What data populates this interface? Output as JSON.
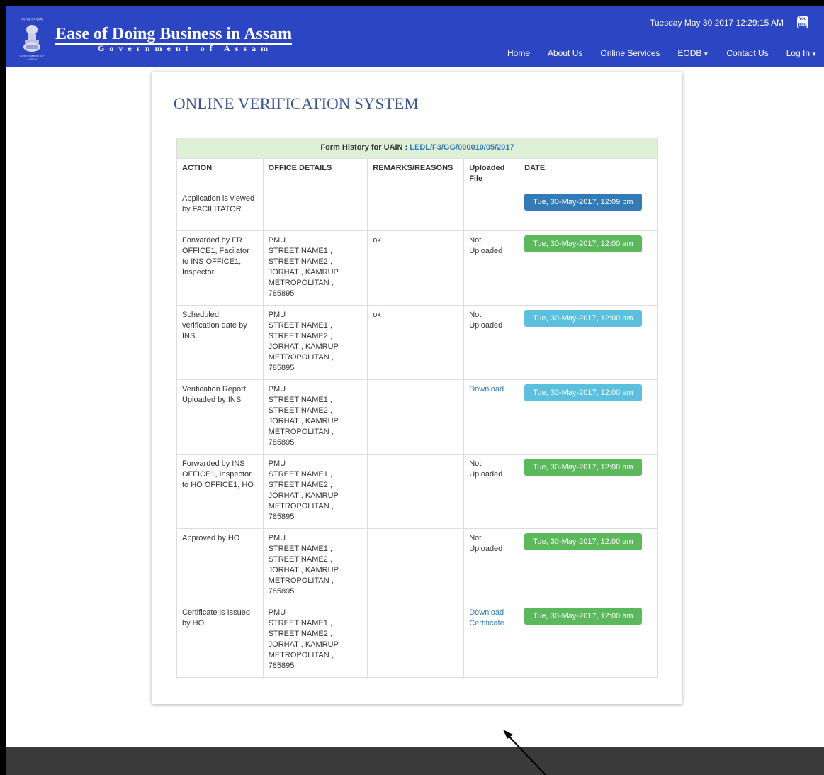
{
  "header": {
    "emblem_top_text": "অসম চৰকাৰ",
    "emblem_bottom_text": "GOVERNMENT OF ASSAM",
    "title": "Ease of Doing Business in Assam",
    "subtitle": "Government of Assam",
    "datetime": "Tuesday May 30 2017 12:29:15 AM",
    "youtube_top": "You",
    "youtube_bottom": "Tube",
    "nav": [
      {
        "label": "Home"
      },
      {
        "label": "About Us"
      },
      {
        "label": "Online Services"
      },
      {
        "label": "EODB",
        "dropdown": true
      },
      {
        "label": "Contact Us"
      },
      {
        "label": "Log In",
        "dropdown": true
      }
    ]
  },
  "main": {
    "page_title": "ONLINE VERIFICATION SYSTEM",
    "caption_prefix": "Form History for UAIN : ",
    "uain": "LEDL/F3/GG/000010/05/2017",
    "columns": [
      "ACTION",
      "OFFICE DETAILS",
      "REMARKS/REASONS",
      "Uploaded File",
      "DATE"
    ],
    "rows": [
      {
        "action": "Application is viewed by FACILITATOR",
        "office": "",
        "remarks": "",
        "file": "",
        "file_is_link": false,
        "date": "Tue, 30-May-2017, 12:09 pm",
        "date_style": "primary"
      },
      {
        "action": "Forwarded by FR OFFICE1, Facilator to INS OFFICE1, Inspector",
        "office": "PMU\nSTREET NAME1 ,\nSTREET NAME2 ,\nJORHAT , KAMRUP\nMETROPOLITAN ,\n785895",
        "remarks": "ok",
        "file": "Not Uploaded",
        "file_is_link": false,
        "date": "Tue, 30-May-2017, 12:00 am",
        "date_style": "success"
      },
      {
        "action": "Scheduled verification date by INS",
        "office": "PMU\nSTREET NAME1 ,\nSTREET NAME2 ,\nJORHAT , KAMRUP\nMETROPOLITAN ,\n785895",
        "remarks": "ok",
        "file": "Not Uploaded",
        "file_is_link": false,
        "date": "Tue, 30-May-2017, 12:00 am",
        "date_style": "info"
      },
      {
        "action": "Verification Report Uploaded by INS",
        "office": "PMU\nSTREET NAME1 ,\nSTREET NAME2 ,\nJORHAT , KAMRUP\nMETROPOLITAN ,\n785895",
        "remarks": "",
        "file": "Download",
        "file_is_link": true,
        "date": "Tue, 30-May-2017, 12:00 am",
        "date_style": "info"
      },
      {
        "action": "Forwarded by INS OFFICE1, Inspector to HO OFFICE1, HO",
        "office": "PMU\nSTREET NAME1 ,\nSTREET NAME2 ,\nJORHAT , KAMRUP\nMETROPOLITAN ,\n785895",
        "remarks": "",
        "file": "Not Uploaded",
        "file_is_link": false,
        "date": "Tue, 30-May-2017, 12:00 am",
        "date_style": "success"
      },
      {
        "action": "Approved by HO",
        "office": "PMU\nSTREET NAME1 ,\nSTREET NAME2 ,\nJORHAT , KAMRUP\nMETROPOLITAN ,\n785895",
        "remarks": "",
        "file": "Not Uploaded",
        "file_is_link": false,
        "date": "Tue, 30-May-2017, 12:00 am",
        "date_style": "success"
      },
      {
        "action": "Certificate is Issued by HO",
        "office": "PMU\nSTREET NAME1 ,\nSTREET NAME2 ,\nJORHAT , KAMRUP\nMETROPOLITAN ,\n785895",
        "remarks": "",
        "file": "Download Certificate",
        "file_is_link": true,
        "date": "Tue, 30-May-2017, 12:00 am",
        "date_style": "success"
      }
    ]
  },
  "colors": {
    "header_bg": "#2c45c2",
    "title_color": "#3a5490",
    "caption_bg": "#dff0d8",
    "link": "#337ab7",
    "btn_primary": "#337ab7",
    "btn_success": "#5cb85c",
    "btn_info": "#5bc0de",
    "footer_bg": "#3a3a3a"
  },
  "icons": [
    "emblem-icon",
    "youtube-icon",
    "caret-down-icon"
  ]
}
